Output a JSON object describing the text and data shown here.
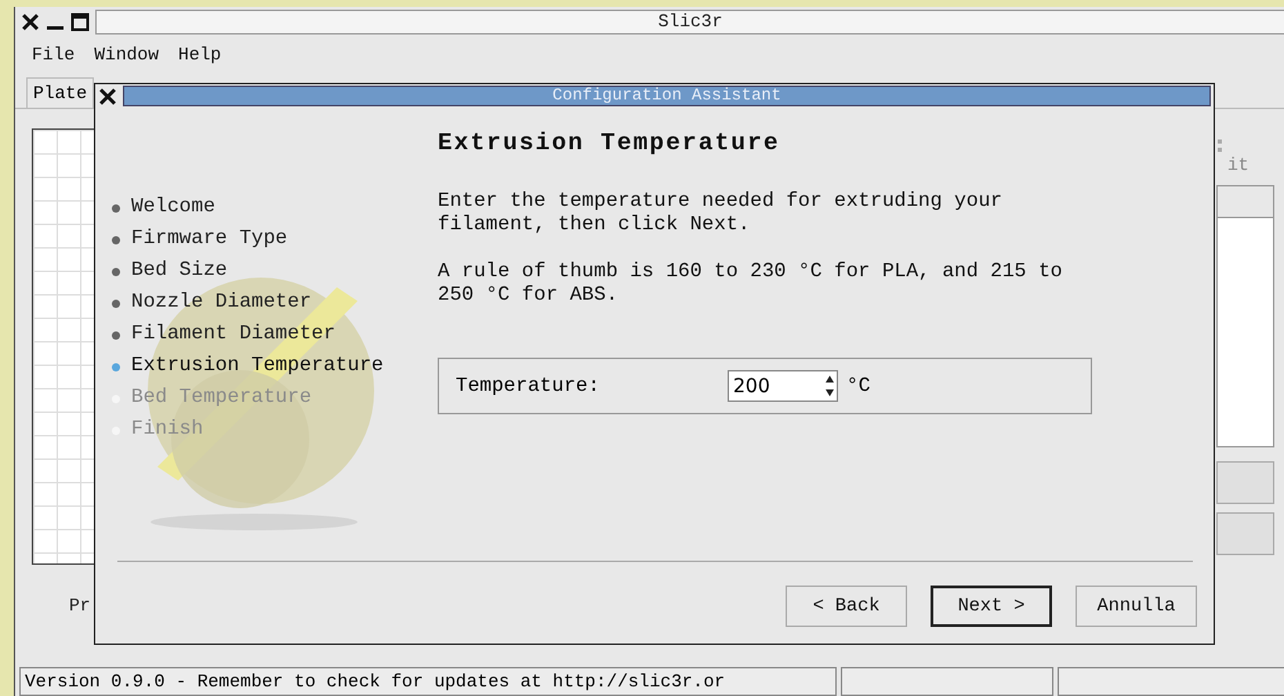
{
  "window": {
    "title": "Slic3r"
  },
  "menu": [
    {
      "label": "File"
    },
    {
      "label": "Window"
    },
    {
      "label": "Help"
    }
  ],
  "tabs": [
    {
      "label": "Plate"
    }
  ],
  "background_texts": {
    "partial_label": "it",
    "bottom_label": "Pr"
  },
  "dialog": {
    "title": "Configuration Assistant",
    "steps": [
      {
        "label": "Welcome",
        "completed": true,
        "selected": false
      },
      {
        "label": "Firmware Type",
        "completed": true,
        "selected": false
      },
      {
        "label": "Bed Size",
        "completed": true,
        "selected": false
      },
      {
        "label": "Nozzle Diameter",
        "completed": true,
        "selected": false
      },
      {
        "label": "Filament Diameter",
        "completed": true,
        "selected": false
      },
      {
        "label": "Extrusion Temperature",
        "completed": false,
        "selected": true
      },
      {
        "label": "Bed Temperature",
        "completed": false,
        "selected": false
      },
      {
        "label": "Finish",
        "completed": false,
        "selected": false
      }
    ],
    "heading": "Extrusion Temperature",
    "paragraphs": [
      "Enter the temperature needed for extruding your filament, then click Next.",
      "A rule of thumb is 160 to 230 °C for PLA, and 215 to 250 °C for ABS."
    ],
    "field": {
      "label": "Temperature:",
      "value": "200",
      "unit": "°C"
    },
    "buttons": [
      {
        "label": "< Back",
        "default": false
      },
      {
        "label": "Next >",
        "default": true
      },
      {
        "label": "Annulla",
        "default": false
      }
    ]
  },
  "status_bar": {
    "message": "Version 0.9.0 - Remember to check for updates at http://slic3r.or"
  }
}
